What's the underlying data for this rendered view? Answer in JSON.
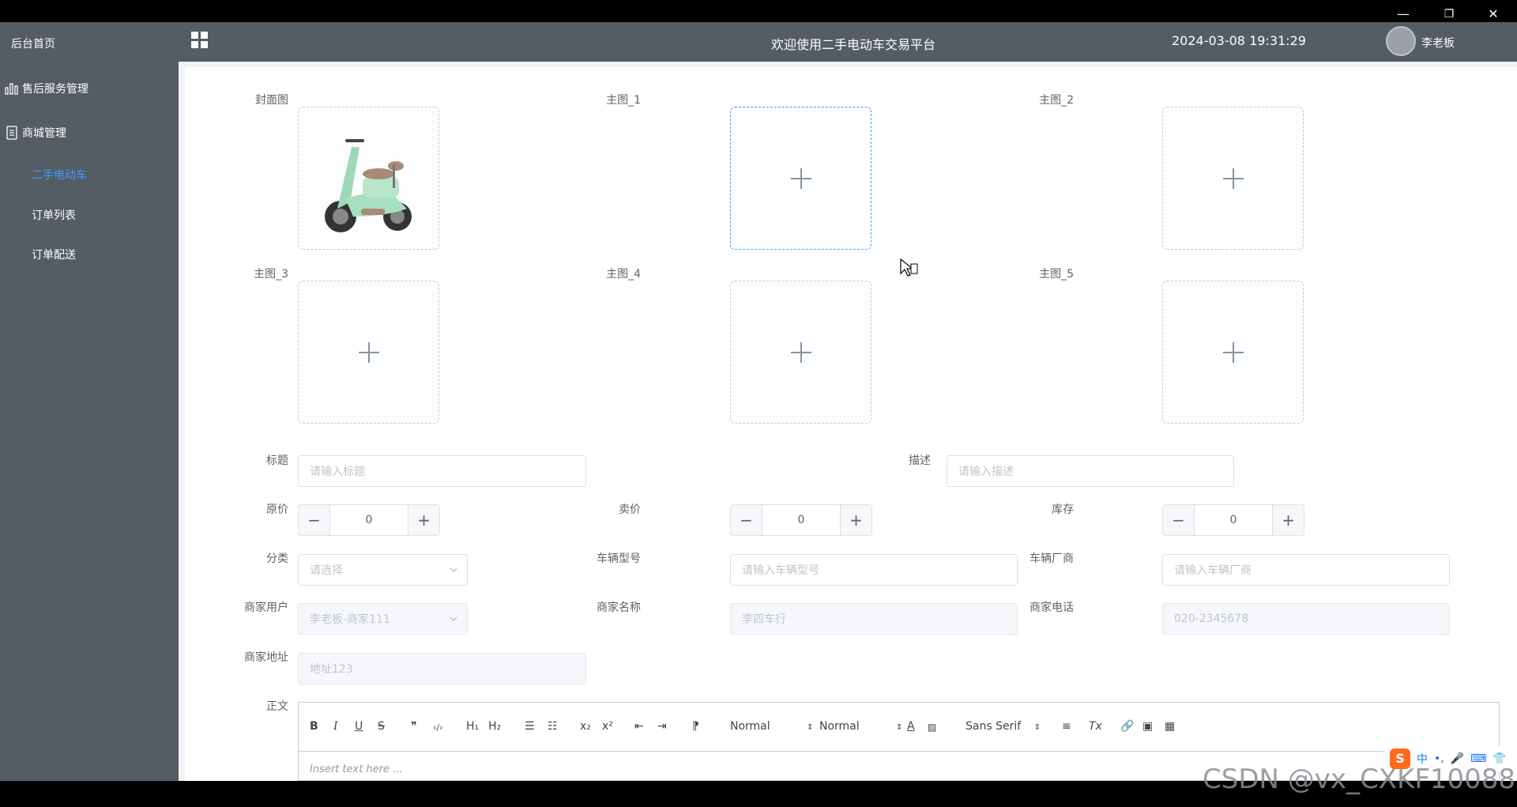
{
  "window": {
    "minimize": "—",
    "restore": "❐",
    "close": "✕"
  },
  "sidebar": {
    "items": [
      {
        "label": "后台首页"
      },
      {
        "label": "售后服务管理"
      },
      {
        "label": "商城管理"
      }
    ],
    "subitems": [
      {
        "label": "二手电动车",
        "active": true
      },
      {
        "label": "订单列表"
      },
      {
        "label": "订单配送"
      }
    ],
    "active_color": "#409eff"
  },
  "header": {
    "title": "欢迎使用二手电动车交易平台",
    "datetime": "2024-03-08 19:31:29",
    "username": "李老板"
  },
  "form": {
    "images": [
      {
        "label": "封面图",
        "has_image": true
      },
      {
        "label": "主图_1"
      },
      {
        "label": "主图_2"
      },
      {
        "label": "主图_3"
      },
      {
        "label": "主图_4"
      },
      {
        "label": "主图_5"
      }
    ],
    "title": {
      "label": "标题",
      "placeholder": "请输入标题"
    },
    "desc": {
      "label": "描述",
      "placeholder": "请输入描述"
    },
    "price_original": {
      "label": "原价",
      "value": "0"
    },
    "price_sale": {
      "label": "卖价",
      "value": "0"
    },
    "stock": {
      "label": "库存",
      "value": "0"
    },
    "category": {
      "label": "分类",
      "placeholder": "请选择"
    },
    "model": {
      "label": "车辆型号",
      "placeholder": "请输入车辆型号"
    },
    "maker": {
      "label": "车辆厂商",
      "placeholder": "请输入车辆厂商"
    },
    "merchant_user": {
      "label": "商家用户",
      "value": "李老板-商家111"
    },
    "merchant_name": {
      "label": "商家名称",
      "value": "李四车行"
    },
    "merchant_phone": {
      "label": "商家电话",
      "value": "020-2345678"
    },
    "merchant_addr": {
      "label": "商家地址",
      "value": "地址123"
    },
    "body": {
      "label": "正文"
    }
  },
  "editor": {
    "toolbar": {
      "bold": "B",
      "italic": "I",
      "underline": "U",
      "strike": "S",
      "quote": "❞",
      "code": "‹/›",
      "h1": "H₁",
      "h2": "H₂",
      "ol": "☰",
      "ul": "☷",
      "sub": "x₂",
      "sup": "x²",
      "outdent": "⇤",
      "indent": "⇥",
      "direction": "⁋",
      "size": "Normal",
      "header": "Normal",
      "font": "Sans Serif",
      "clean": "Tx"
    },
    "placeholder": "Insert text here ..."
  },
  "ime": {
    "logo": "S",
    "lang": "中",
    "punct": "•,",
    "mic": "🎤",
    "keyboard": "⌨",
    "skin": "👕"
  },
  "watermark": "CSDN @vx_CXKF10088"
}
